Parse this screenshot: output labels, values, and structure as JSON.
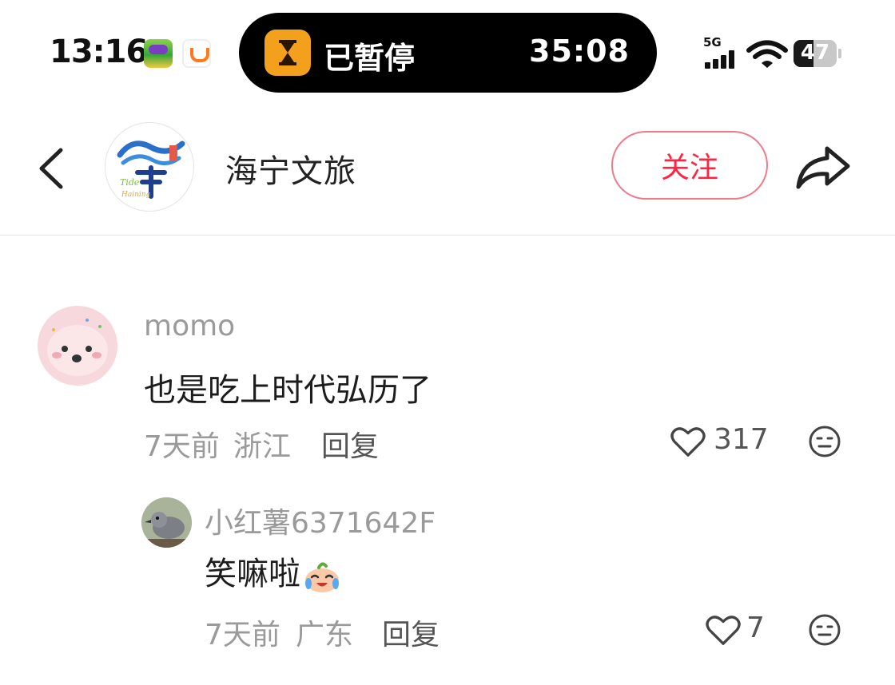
{
  "status_bar": {
    "time": "13:16",
    "network": "5G",
    "battery_level": "47",
    "battery_fraction": 0.47
  },
  "island": {
    "status": "已暂停",
    "timer": "35:08"
  },
  "header": {
    "account_name": "海宁文旅",
    "follow_label": "关注"
  },
  "comments": [
    {
      "username": "momo",
      "text": "也是吃上时代弘历了",
      "time": "7天前",
      "location": "浙江",
      "reply_label": "回复",
      "likes": "317"
    },
    {
      "username": "小红薯6371642F",
      "text": "笑嘛啦",
      "time": "7天前",
      "location": "广东",
      "reply_label": "回复",
      "likes": "7"
    }
  ],
  "colors": {
    "accent": "#ff2442",
    "follow_border": "#f07a8a",
    "muted_text": "#9a9a9a"
  }
}
